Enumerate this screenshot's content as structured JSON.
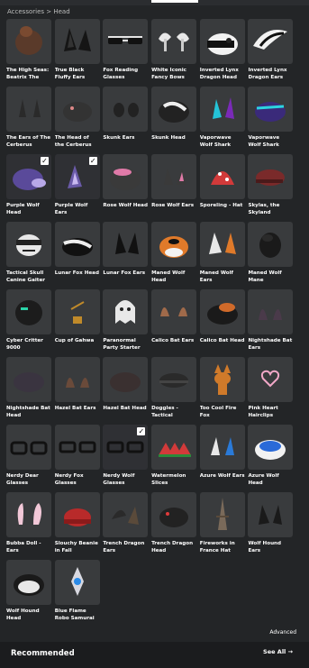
{
  "breadcrumb": "Accessories > Head",
  "advanced_label": "Advanced",
  "recommended": {
    "title": "Recommended",
    "see_all": "See All →"
  },
  "items": [
    {
      "name": "The High Seas: Beatrix The",
      "icon": "brown-head-icon",
      "selected": false
    },
    {
      "name": "True Black Fluffy Ears",
      "icon": "black-ears-icon",
      "selected": false
    },
    {
      "name": "Fox Reading Glasses",
      "icon": "glasses-icon",
      "selected": false
    },
    {
      "name": "White Iconic Fancy Bows",
      "icon": "bows-icon",
      "selected": false
    },
    {
      "name": "Inverted Lynx Dragon Head",
      "icon": "white-dragon-head-icon",
      "selected": false
    },
    {
      "name": "Inverted Lynx Dragon Ears",
      "icon": "white-dragon-ears-icon",
      "selected": false
    },
    {
      "name": "The Ears of The Cerberus",
      "icon": "cerberus-ears-icon",
      "selected": false
    },
    {
      "name": "The Head of the Cerberus",
      "icon": "cerberus-head-icon",
      "selected": false
    },
    {
      "name": "Skunk Ears",
      "icon": "skunk-ears-icon",
      "selected": false
    },
    {
      "name": "Skunk Head",
      "icon": "skunk-head-icon",
      "selected": false
    },
    {
      "name": "Vaporwave Wolf Shark",
      "icon": "vaporwave-ears-icon",
      "selected": false
    },
    {
      "name": "Vaporwave Wolf Shark",
      "icon": "vaporwave-head-icon",
      "selected": false
    },
    {
      "name": "Purple Wolf Head",
      "icon": "purple-wolf-head-icon",
      "selected": true
    },
    {
      "name": "Purple Wolf Ears",
      "icon": "purple-wolf-ears-icon",
      "selected": true
    },
    {
      "name": "Rose Wolf Head",
      "icon": "rose-wolf-head-icon",
      "selected": false
    },
    {
      "name": "Rose Wolf Ears",
      "icon": "rose-wolf-ears-icon",
      "selected": false
    },
    {
      "name": "Sporeling - Hat",
      "icon": "mushroom-hat-icon",
      "selected": false
    },
    {
      "name": "Skylas, the Skyland",
      "icon": "beret-icon",
      "selected": false
    },
    {
      "name": "Tactical Skull Canine Gaiter",
      "icon": "skull-gaiter-icon",
      "selected": false
    },
    {
      "name": "Lunar Fox Head",
      "icon": "lunar-fox-head-icon",
      "selected": false
    },
    {
      "name": "Lunar Fox Ears",
      "icon": "lunar-fox-ears-icon",
      "selected": false
    },
    {
      "name": "Maned Wolf Head",
      "icon": "maned-wolf-head-icon",
      "selected": false
    },
    {
      "name": "Maned Wolf Ears",
      "icon": "maned-wolf-ears-icon",
      "selected": false
    },
    {
      "name": "Maned Wolf Mane",
      "icon": "mane-icon",
      "selected": false
    },
    {
      "name": "Cyber Critter 9000",
      "icon": "cyber-helmet-icon",
      "selected": false
    },
    {
      "name": "Cup of Gahwa",
      "icon": "coffee-cup-icon",
      "selected": false
    },
    {
      "name": "Paranormal Party Starter",
      "icon": "ghost-icon",
      "selected": false
    },
    {
      "name": "Calico Bat Ears",
      "icon": "bat-ears-icon",
      "selected": false
    },
    {
      "name": "Calico Bat Head",
      "icon": "bat-head-icon",
      "selected": false
    },
    {
      "name": "Nightshade Bat Ears",
      "icon": "nightshade-ears-icon",
      "selected": false
    },
    {
      "name": "Nightshade Bat Head",
      "icon": "nightshade-head-icon",
      "selected": false
    },
    {
      "name": "Hazel Bat Ears",
      "icon": "hazel-ears-icon",
      "selected": false
    },
    {
      "name": "Hazel Bat Head",
      "icon": "hazel-head-icon",
      "selected": false
    },
    {
      "name": "Doggles - Tactical",
      "icon": "goggles-icon",
      "selected": false
    },
    {
      "name": "Too Cool Fire Fox",
      "icon": "fire-fox-icon",
      "selected": false
    },
    {
      "name": "Pink Heart Hairclips",
      "icon": "heart-clip-icon",
      "selected": false
    },
    {
      "name": "Nerdy Dear Glasses",
      "icon": "nerdy-glasses-icon",
      "selected": false
    },
    {
      "name": "Nerdy Fox Glasses",
      "icon": "nerdy-fox-glasses-icon",
      "selected": false
    },
    {
      "name": "Nerdy Wolf Glasses",
      "icon": "nerdy-wolf-glasses-icon",
      "selected": true
    },
    {
      "name": "Watermelon Slices",
      "icon": "watermelon-icon",
      "selected": false
    },
    {
      "name": "Azure Wolf Ears",
      "icon": "azure-ears-icon",
      "selected": false
    },
    {
      "name": "Azure Wolf Head",
      "icon": "azure-head-icon",
      "selected": false
    },
    {
      "name": "Bubba Doll - Ears",
      "icon": "doll-ears-icon",
      "selected": false
    },
    {
      "name": "Slouchy Beanie in Fall",
      "icon": "beanie-icon",
      "selected": false
    },
    {
      "name": "Trench Dragon Ears",
      "icon": "trench-ears-icon",
      "selected": false
    },
    {
      "name": "Trench Dragon Head",
      "icon": "trench-head-icon",
      "selected": false
    },
    {
      "name": "Fireworks in France Hat",
      "icon": "eiffel-tower-icon",
      "selected": false
    },
    {
      "name": "Wolf Hound Ears",
      "icon": "hound-ears-icon",
      "selected": false
    },
    {
      "name": "Wolf Hound Head",
      "icon": "hound-head-icon",
      "selected": false
    },
    {
      "name": "Blue Flame Robo Samurai",
      "icon": "robo-samurai-icon",
      "selected": false
    }
  ]
}
